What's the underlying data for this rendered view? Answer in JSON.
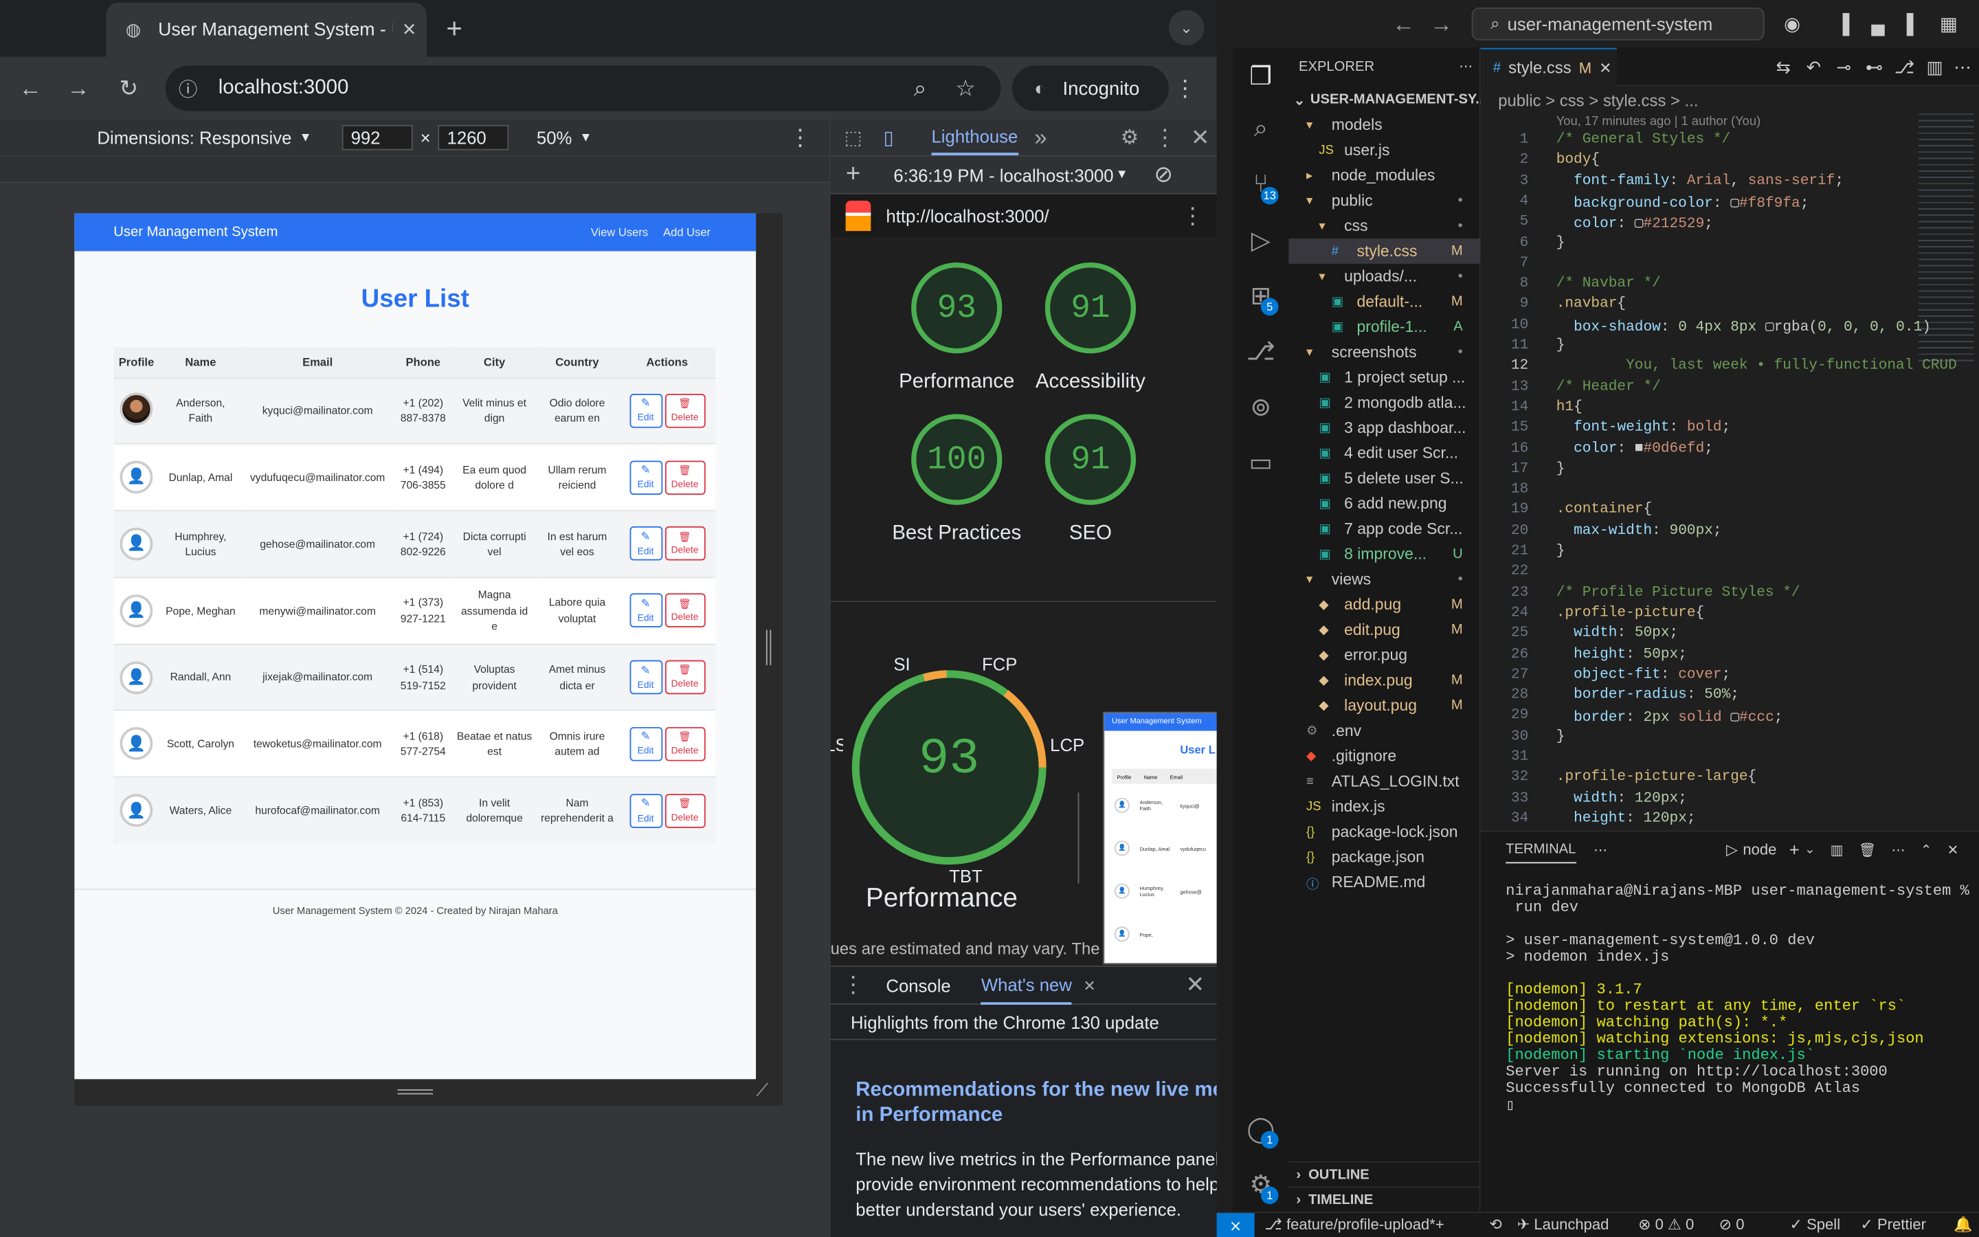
{
  "browser": {
    "tab_title": "User Management System - U",
    "url": "localhost:3000",
    "incognito_label": "Incognito"
  },
  "device_toolbar": {
    "dimensions_label": "Dimensions: Responsive",
    "width": "992",
    "height": "1260",
    "zoom": "50%"
  },
  "app": {
    "brand": "User Management System",
    "nav_links": [
      "View Users",
      "Add User"
    ],
    "title": "User List",
    "columns": [
      "Profile",
      "Name",
      "Email",
      "Phone",
      "City",
      "Country",
      "Actions"
    ],
    "rows": [
      {
        "name": "Anderson, Faith",
        "email": "kyquci@mailinator.com",
        "phone": "+1 (202) 887-8378",
        "city": "Velit minus et dign",
        "country": "Odio dolore earum en",
        "photo": true
      },
      {
        "name": "Dunlap, Amal",
        "email": "vydufuqecu@mailinator.com",
        "phone": "+1 (494) 706-3855",
        "city": "Ea eum quod dolore d",
        "country": "Ullam rerum reiciend",
        "photo": false
      },
      {
        "name": "Humphrey, Lucius",
        "email": "gehose@mailinator.com",
        "phone": "+1 (724) 802-9226",
        "city": "Dicta corrupti vel",
        "country": "In est harum vel eos",
        "photo": false
      },
      {
        "name": "Pope, Meghan",
        "email": "menywi@mailinator.com",
        "phone": "+1 (373) 927-1221",
        "city": "Magna assumenda id e",
        "country": "Labore quia voluptat",
        "photo": false
      },
      {
        "name": "Randall, Ann",
        "email": "jixejak@mailinator.com",
        "phone": "+1 (514) 519-7152",
        "city": "Voluptas provident",
        "country": "Amet minus dicta er",
        "photo": false
      },
      {
        "name": "Scott, Carolyn",
        "email": "tewoketus@mailinator.com",
        "phone": "+1 (618) 577-2754",
        "city": "Beatae et natus est",
        "country": "Omnis irure autem ad",
        "photo": false
      },
      {
        "name": "Waters, Alice",
        "email": "hurofocaf@mailinator.com",
        "phone": "+1 (853) 614-7115",
        "city": "In velit doloremque",
        "country": "Nam reprehenderit a",
        "photo": false
      }
    ],
    "edit_label": "Edit",
    "delete_label": "Delete",
    "footer": "User Management System © 2024 - Created by Nirajan Mahara"
  },
  "devtools": {
    "panel": "Lighthouse",
    "report_time": "6:36:19 PM - localhost:3000",
    "report_url": "http://localhost:3000/",
    "scores": [
      {
        "label": "Performance",
        "value": "93"
      },
      {
        "label": "Accessibility",
        "value": "91"
      },
      {
        "label": "Best Practices",
        "value": "100"
      },
      {
        "label": "SEO",
        "value": "91"
      }
    ],
    "metric_labels": [
      "SI",
      "FCP",
      "LCP",
      "TBT",
      "LS"
    ],
    "big_score": "93",
    "big_label": "Performance",
    "estimated_text": "ues are estimated and may vary. The",
    "drawer_tabs": [
      "Console",
      "What's new"
    ],
    "drawer_heading": "Highlights from the Chrome 130 update",
    "drawer_link": "Recommendations for the new live metrics in Performance",
    "drawer_link_l1": "Recommendations for the new live met",
    "drawer_link_l2": "in Performance",
    "drawer_body_l1": "The new live metrics in the Performance panel",
    "drawer_body_l2": "provide environment recommendations to help",
    "drawer_body_l3": "better understand your users' experience.",
    "preview_brand": "User Management System",
    "preview_title": "User L",
    "preview_cols": [
      "Profile",
      "Name",
      "Email"
    ],
    "preview_rows": [
      {
        "name": "Anderson, Faith",
        "email": "kyquci@"
      },
      {
        "name": "Dunlap, Amal",
        "email": "vydufuqecu"
      },
      {
        "name": "Humphrey, Lucius",
        "email": "gehose@"
      },
      {
        "name": "Pope,",
        "email": ""
      }
    ]
  },
  "vscode": {
    "search": "user-management-system",
    "explorer_title": "EXPLORER",
    "root": "USER-MANAGEMENT-SY...",
    "tree": [
      {
        "label": "models",
        "indent": 1,
        "kind": "folder-open",
        "status": ""
      },
      {
        "label": "user.js",
        "indent": 2,
        "kind": "js",
        "status": ""
      },
      {
        "label": "node_modules",
        "indent": 1,
        "kind": "folder",
        "status": ""
      },
      {
        "label": "public",
        "indent": 1,
        "kind": "folder-open",
        "status": "•"
      },
      {
        "label": "css",
        "indent": 2,
        "kind": "folder-open",
        "status": "•"
      },
      {
        "label": "style.css",
        "indent": 3,
        "kind": "css",
        "status": "M"
      },
      {
        "label": "uploads/...",
        "indent": 2,
        "kind": "folder-open",
        "status": "•"
      },
      {
        "label": "default-...",
        "indent": 3,
        "kind": "img",
        "status": "M"
      },
      {
        "label": "profile-1...",
        "indent": 3,
        "kind": "img",
        "status": "A"
      },
      {
        "label": "screenshots",
        "indent": 1,
        "kind": "folder-open",
        "status": "•"
      },
      {
        "label": "1 project setup ...",
        "indent": 2,
        "kind": "img",
        "status": ""
      },
      {
        "label": "2 mongodb atla...",
        "indent": 2,
        "kind": "img",
        "status": ""
      },
      {
        "label": "3 app dashboar...",
        "indent": 2,
        "kind": "img",
        "status": ""
      },
      {
        "label": "4 edit user Scr...",
        "indent": 2,
        "kind": "img",
        "status": ""
      },
      {
        "label": "5 delete user S...",
        "indent": 2,
        "kind": "img",
        "status": ""
      },
      {
        "label": "6 add new.png",
        "indent": 2,
        "kind": "img",
        "status": ""
      },
      {
        "label": "7 app code Scr...",
        "indent": 2,
        "kind": "img",
        "status": ""
      },
      {
        "label": "8 improve...",
        "indent": 2,
        "kind": "img",
        "status": "U"
      },
      {
        "label": "views",
        "indent": 1,
        "kind": "folder-open",
        "status": "•"
      },
      {
        "label": "add.pug",
        "indent": 2,
        "kind": "pug",
        "status": "M"
      },
      {
        "label": "edit.pug",
        "indent": 2,
        "kind": "pug",
        "status": "M"
      },
      {
        "label": "error.pug",
        "indent": 2,
        "kind": "pug",
        "status": ""
      },
      {
        "label": "index.pug",
        "indent": 2,
        "kind": "pug",
        "status": "M"
      },
      {
        "label": "layout.pug",
        "indent": 2,
        "kind": "pug",
        "status": "M"
      },
      {
        "label": ".env",
        "indent": 1,
        "kind": "env",
        "status": ""
      },
      {
        "label": ".gitignore",
        "indent": 1,
        "kind": "git",
        "status": ""
      },
      {
        "label": "ATLAS_LOGIN.txt",
        "indent": 1,
        "kind": "txt",
        "status": ""
      },
      {
        "label": "index.js",
        "indent": 1,
        "kind": "js",
        "status": ""
      },
      {
        "label": "package-lock.json",
        "indent": 1,
        "kind": "json",
        "status": ""
      },
      {
        "label": "package.json",
        "indent": 1,
        "kind": "json",
        "status": ""
      },
      {
        "label": "README.md",
        "indent": 1,
        "kind": "info",
        "status": ""
      }
    ],
    "outline": "OUTLINE",
    "timeline": "TIMELINE",
    "tab_file": "style.css",
    "tab_status": "M",
    "breadcrumb": "public > css > style.css > ...",
    "blame": "You, 17 minutes ago | 1 author (You)",
    "code": [
      [
        [
          "c-cm",
          "/* General Styles */"
        ]
      ],
      [
        [
          "c-sel",
          "body"
        ],
        [
          "",
          "{"
        ]
      ],
      [
        [
          "",
          "  "
        ],
        [
          "c-prop",
          "font-family"
        ],
        [
          "",
          ": "
        ],
        [
          "c-val",
          "Arial"
        ],
        [
          "",
          ", "
        ],
        [
          "c-val",
          "sans-serif"
        ],
        [
          "",
          ";"
        ]
      ],
      [
        [
          "",
          "  "
        ],
        [
          "c-prop",
          "background-color"
        ],
        [
          "",
          ": ▢"
        ],
        [
          "c-val",
          "#f8f9fa"
        ],
        [
          "",
          ";"
        ]
      ],
      [
        [
          "",
          "  "
        ],
        [
          "c-prop",
          "color"
        ],
        [
          "",
          ": ▢"
        ],
        [
          "c-val",
          "#212529"
        ],
        [
          "",
          ";"
        ]
      ],
      [
        [
          "",
          "}"
        ]
      ],
      [
        [
          "",
          ""
        ]
      ],
      [
        [
          "c-cm",
          "/* Navbar */"
        ]
      ],
      [
        [
          "c-sel",
          ".navbar"
        ],
        [
          "",
          "{"
        ]
      ],
      [
        [
          "",
          "  "
        ],
        [
          "c-prop",
          "box-shadow"
        ],
        [
          "",
          ": "
        ],
        [
          "c-num",
          "0 4px 8px"
        ],
        [
          "",
          " ▢rgba("
        ],
        [
          "c-num",
          "0, 0, 0, 0.1"
        ],
        [
          "",
          ")"
        ]
      ],
      [
        [
          "",
          "}"
        ]
      ],
      [
        [
          "c-cm",
          "        You, last week • fully-functional CRUD"
        ]
      ],
      [
        [
          "c-cm",
          "/* Header */"
        ]
      ],
      [
        [
          "c-sel",
          "h1"
        ],
        [
          "",
          "{"
        ]
      ],
      [
        [
          "",
          "  "
        ],
        [
          "c-prop",
          "font-weight"
        ],
        [
          "",
          ": "
        ],
        [
          "c-val",
          "bold"
        ],
        [
          "",
          ";"
        ]
      ],
      [
        [
          "",
          "  "
        ],
        [
          "c-prop",
          "color"
        ],
        [
          "",
          ": ■"
        ],
        [
          "c-val",
          "#0d6efd"
        ],
        [
          "",
          ";"
        ]
      ],
      [
        [
          "",
          "}"
        ]
      ],
      [
        [
          "",
          ""
        ]
      ],
      [
        [
          "c-sel",
          ".container"
        ],
        [
          "",
          "{"
        ]
      ],
      [
        [
          "",
          "  "
        ],
        [
          "c-prop",
          "max-width"
        ],
        [
          "",
          ": "
        ],
        [
          "c-num",
          "900px"
        ],
        [
          "",
          ";"
        ]
      ],
      [
        [
          "",
          "}"
        ]
      ],
      [
        [
          "",
          ""
        ]
      ],
      [
        [
          "c-cm",
          "/* Profile Picture Styles */"
        ]
      ],
      [
        [
          "c-sel",
          ".profile-picture"
        ],
        [
          "",
          "{"
        ]
      ],
      [
        [
          "",
          "  "
        ],
        [
          "c-prop",
          "width"
        ],
        [
          "",
          ": "
        ],
        [
          "c-num",
          "50px"
        ],
        [
          "",
          ";"
        ]
      ],
      [
        [
          "",
          "  "
        ],
        [
          "c-prop",
          "height"
        ],
        [
          "",
          ": "
        ],
        [
          "c-num",
          "50px"
        ],
        [
          "",
          ";"
        ]
      ],
      [
        [
          "",
          "  "
        ],
        [
          "c-prop",
          "object-fit"
        ],
        [
          "",
          ": "
        ],
        [
          "c-val",
          "cover"
        ],
        [
          "",
          ";"
        ]
      ],
      [
        [
          "",
          "  "
        ],
        [
          "c-prop",
          "border-radius"
        ],
        [
          "",
          ": "
        ],
        [
          "c-num",
          "50%"
        ],
        [
          "",
          ";"
        ]
      ],
      [
        [
          "",
          "  "
        ],
        [
          "c-prop",
          "border"
        ],
        [
          "",
          ": "
        ],
        [
          "c-num",
          "2px"
        ],
        [
          "",
          " "
        ],
        [
          "c-val",
          "solid"
        ],
        [
          "",
          " ▢"
        ],
        [
          "c-val",
          "#ccc"
        ],
        [
          "",
          ";"
        ]
      ],
      [
        [
          "",
          "}"
        ]
      ],
      [
        [
          "",
          ""
        ]
      ],
      [
        [
          "c-sel",
          ".profile-picture-large"
        ],
        [
          "",
          "{"
        ]
      ],
      [
        [
          "",
          "  "
        ],
        [
          "c-prop",
          "width"
        ],
        [
          "",
          ": "
        ],
        [
          "c-num",
          "120px"
        ],
        [
          "",
          ";"
        ]
      ],
      [
        [
          "",
          "  "
        ],
        [
          "c-prop",
          "height"
        ],
        [
          "",
          ": "
        ],
        [
          "c-num",
          "120px"
        ],
        [
          "",
          ";"
        ]
      ]
    ],
    "terminal_title": "TERMINAL",
    "terminal_shell": "node",
    "terminal_lines": [
      [
        "",
        "nirajanmahara@Nirajans-MBP user-management-system % npm"
      ],
      [
        "",
        " run dev"
      ],
      [
        "",
        ""
      ],
      [
        "",
        "> user-management-system@1.0.0 dev"
      ],
      [
        "",
        "> nodemon index.js"
      ],
      [
        "",
        ""
      ],
      [
        "yel",
        "[nodemon] 3.1.7"
      ],
      [
        "yel",
        "[nodemon] to restart at any time, enter `rs`"
      ],
      [
        "yel",
        "[nodemon] watching path(s): *.*"
      ],
      [
        "yel",
        "[nodemon] watching extensions: js,mjs,cjs,json"
      ],
      [
        "grn",
        "[nodemon] starting `node index.js`"
      ],
      [
        "",
        "Server is running on http://localhost:3000"
      ],
      [
        "",
        "Successfully connected to MongoDB Atlas"
      ],
      [
        "",
        "▯"
      ]
    ],
    "status_branch": "feature/profile-upload*+",
    "status_launchpad": "Launchpad",
    "status_errors": "⊗ 0 ⚠ 0",
    "status_ports": "⊘ 0",
    "status_spell": "✓ Spell",
    "status_prettier": "✓ Prettier",
    "badges": {
      "scm": "13",
      "ext": "5",
      "account": "1",
      "settings": "1"
    }
  },
  "colors": {
    "brand_blue": "#2b72f2",
    "delete_red": "#dc3545",
    "score_green": "#4caf50",
    "vscode_accent": "#0078d4"
  }
}
